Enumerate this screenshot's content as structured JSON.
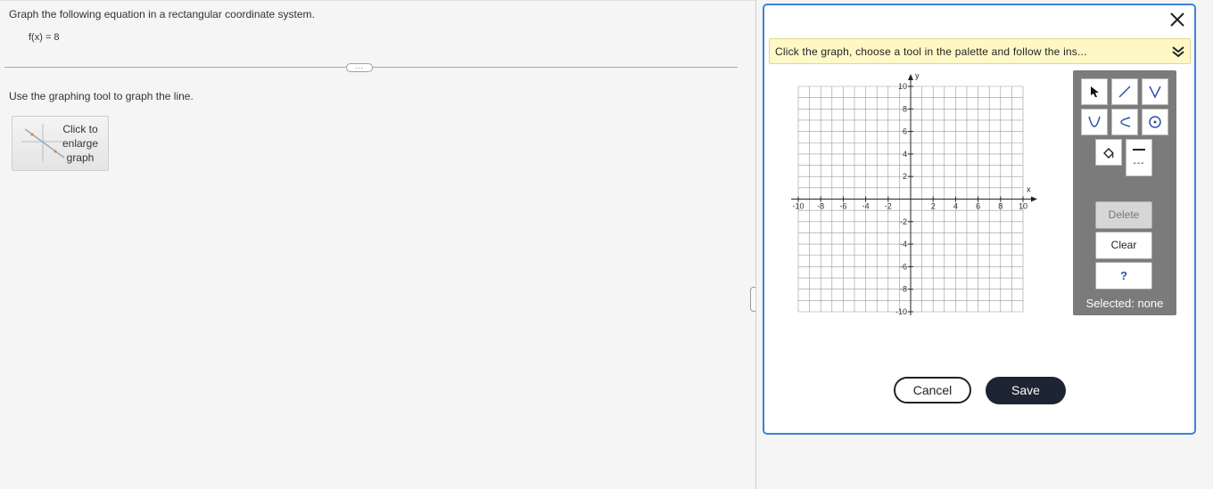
{
  "question": {
    "title": "Graph the following equation in a rectangular coordinate system.",
    "equation": "f(x) = 8",
    "more_button": "...",
    "instruction": "Use the graphing tool to graph the line.",
    "enlarge_label": "Click to enlarge graph"
  },
  "dialog": {
    "banner": "Click the graph, choose a tool in the palette and follow the ins...",
    "axis_x_label": "x",
    "axis_y_label": "y",
    "x_ticks": [
      "-10",
      "-8",
      "-6",
      "-4",
      "-2",
      "2",
      "4",
      "6",
      "8",
      "10"
    ],
    "y_ticks": [
      "10",
      "8",
      "6",
      "4",
      "2",
      "-2",
      "-4",
      "-6",
      "-8",
      "-10"
    ],
    "x_range": [
      -10,
      10
    ],
    "y_range": [
      -10,
      10
    ],
    "palette": {
      "tools": [
        "pointer-icon",
        "line-tool-icon",
        "vertex-up-icon",
        "parabola-icon",
        "open-left-icon",
        "circle-icon",
        "fill-icon",
        "solid-line-icon"
      ],
      "dashed_label": "---",
      "delete_label": "Delete",
      "clear_label": "Clear",
      "help_label": "?",
      "selected": "Selected: none"
    },
    "cancel_label": "Cancel",
    "save_label": "Save"
  },
  "colors": {
    "dialog_border": "#3b82d6",
    "banner_bg": "#fff8c6",
    "palette_bg": "#7b7b7b",
    "save_bg": "#1d2533"
  }
}
